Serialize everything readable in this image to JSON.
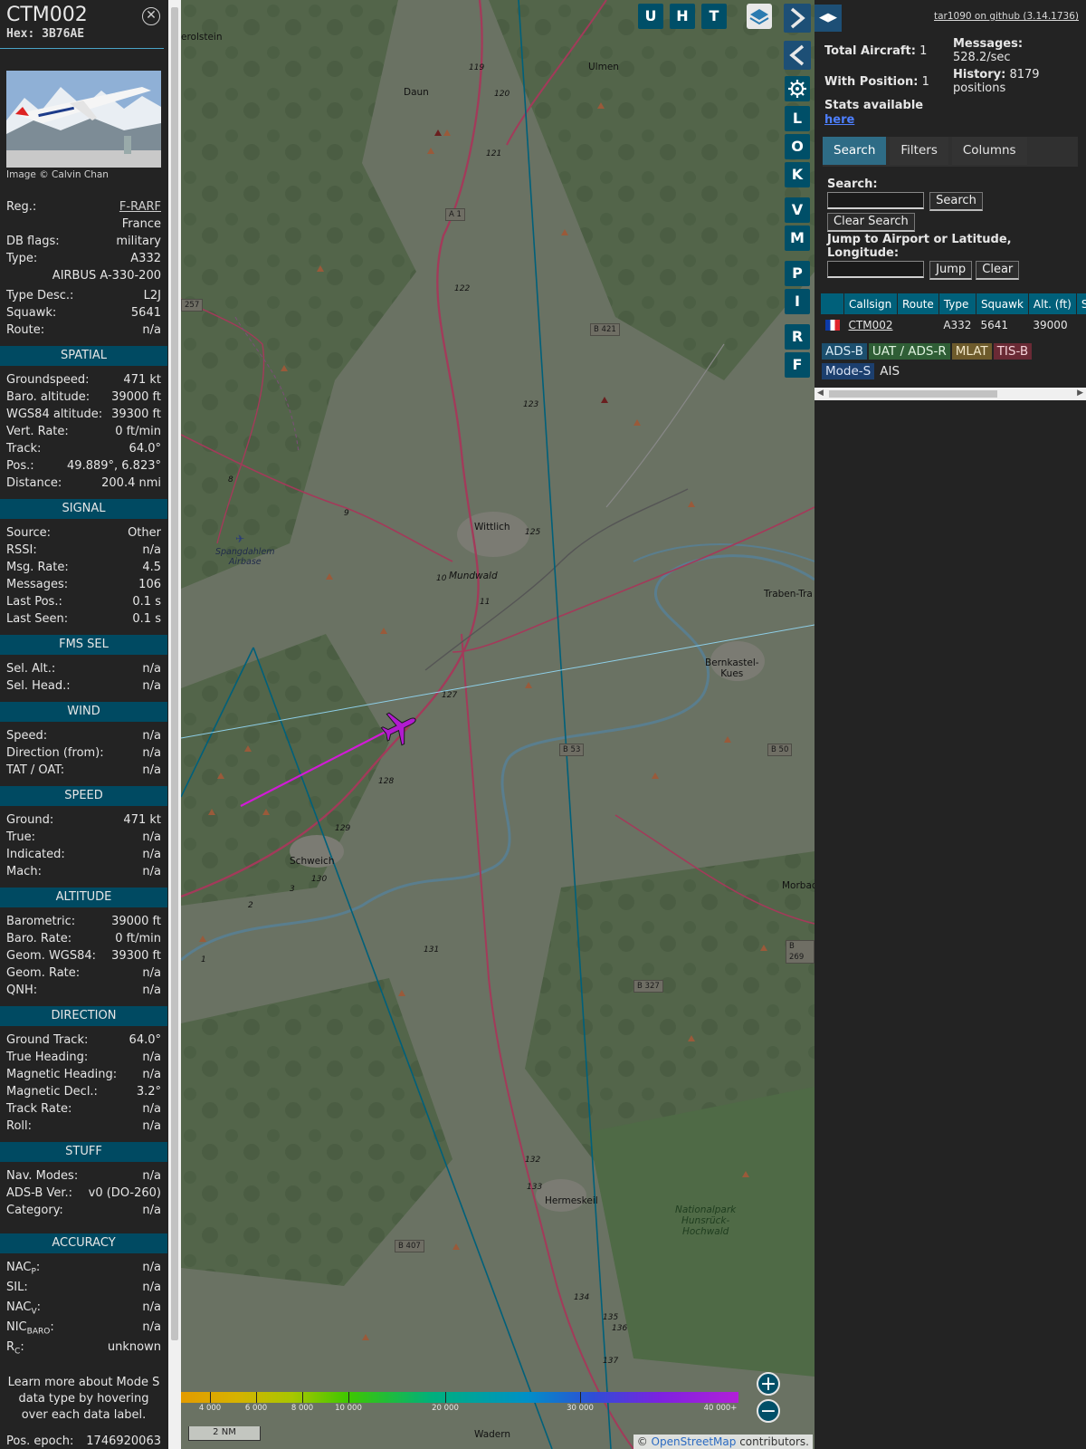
{
  "aircraft": {
    "callsign": "CTM002",
    "hex_label": "Hex:",
    "hex": "3B76AE",
    "photo_credit": "Image © Calvin Chan",
    "reg_label": "Reg.:",
    "reg": "F-RARF",
    "country": "France",
    "dbflags_label": "DB flags:",
    "dbflags": "military",
    "type_label": "Type:",
    "type": "A332",
    "type_full": "AIRBUS A-330-200",
    "typedesc_label": "Type Desc.:",
    "typedesc": "L2J",
    "squawk_label": "Squawk:",
    "squawk": "5641",
    "route_label": "Route:",
    "route": "n/a"
  },
  "sections": {
    "spatial": {
      "title": "SPATIAL",
      "rows": [
        {
          "label": "Groundspeed:",
          "value": "471 kt"
        },
        {
          "label": "Baro. altitude:",
          "value": "39000 ft"
        },
        {
          "label": "WGS84 altitude:",
          "value": "39300 ft"
        },
        {
          "label": "Vert. Rate:",
          "value": "0 ft/min"
        },
        {
          "label": "Track:",
          "value": "64.0°"
        },
        {
          "label": "Pos.:",
          "value": "49.889°, 6.823°"
        },
        {
          "label": "Distance:",
          "value": "200.4 nmi"
        }
      ]
    },
    "signal": {
      "title": "SIGNAL",
      "rows": [
        {
          "label": "Source:",
          "value": "Other"
        },
        {
          "label": "RSSI:",
          "value": "n/a"
        },
        {
          "label": "Msg. Rate:",
          "value": "4.5"
        },
        {
          "label": "Messages:",
          "value": "106"
        },
        {
          "label": "Last Pos.:",
          "value": "0.1 s"
        },
        {
          "label": "Last Seen:",
          "value": "0.1 s"
        }
      ]
    },
    "fms": {
      "title": "FMS SEL",
      "rows": [
        {
          "label": "Sel. Alt.:",
          "value": "n/a"
        },
        {
          "label": "Sel. Head.:",
          "value": "n/a"
        }
      ]
    },
    "wind": {
      "title": "WIND",
      "rows": [
        {
          "label": "Speed:",
          "value": "n/a"
        },
        {
          "label": "Direction (from):",
          "value": "n/a"
        },
        {
          "label": "TAT / OAT:",
          "value": "n/a"
        }
      ]
    },
    "speed": {
      "title": "SPEED",
      "rows": [
        {
          "label": "Ground:",
          "value": "471 kt"
        },
        {
          "label": "True:",
          "value": "n/a"
        },
        {
          "label": "Indicated:",
          "value": "n/a"
        },
        {
          "label": "Mach:",
          "value": "n/a"
        }
      ]
    },
    "altitude": {
      "title": "ALTITUDE",
      "rows": [
        {
          "label": "Barometric:",
          "value": "39000 ft"
        },
        {
          "label": "Baro. Rate:",
          "value": "0 ft/min"
        },
        {
          "label": "Geom. WGS84:",
          "value": "39300 ft"
        },
        {
          "label": "Geom. Rate:",
          "value": "n/a"
        },
        {
          "label": "QNH:",
          "value": "n/a"
        }
      ]
    },
    "direction": {
      "title": "DIRECTION",
      "rows": [
        {
          "label": "Ground Track:",
          "value": "64.0°"
        },
        {
          "label": "True Heading:",
          "value": "n/a"
        },
        {
          "label": "Magnetic Heading:",
          "value": "n/a"
        },
        {
          "label": "Magnetic Decl.:",
          "value": "3.2°"
        },
        {
          "label": "Track Rate:",
          "value": "n/a"
        },
        {
          "label": "Roll:",
          "value": "n/a"
        }
      ]
    },
    "stuff": {
      "title": "STUFF",
      "rows": [
        {
          "label": "Nav. Modes:",
          "value": "n/a"
        },
        {
          "label": "ADS-B Ver.:",
          "value": "v0 (DO-260)"
        },
        {
          "label": "Category:",
          "value": "n/a"
        }
      ]
    },
    "accuracy": {
      "title": "ACCURACY",
      "nacp_main": "NAC",
      "nacp_sub": "P",
      "nacp_value": "n/a",
      "sil_label": "SIL:",
      "sil_value": "n/a",
      "nacv_main": "NAC",
      "nacv_sub": "V",
      "nacv_value": "n/a",
      "nic_main": "NIC",
      "nic_sub": "BARO",
      "nic_value": "n/a",
      "rc_main": "R",
      "rc_sub": "C",
      "rc_value": "unknown"
    },
    "learn_more": "Learn more about Mode S data type by hovering over each data label.",
    "pos_epoch_label": "Pos. epoch:",
    "pos_epoch": "1746920063"
  },
  "map": {
    "towns": [
      "erolstein",
      "Ulmen",
      "Daun",
      "Wittlich",
      "Mundwald",
      "Traben-Tra",
      "Bernkastel-",
      "Kues",
      "Schweich",
      "Morbac",
      "Hermeskeil",
      "Nationalpark",
      "Hunsrück-",
      "Hochwald",
      "Wadern",
      "Spangdahlem",
      "Airbase"
    ],
    "roads": [
      "A 1",
      "B 421",
      "B 53",
      "B 50",
      "B 269",
      "B 327",
      "B 407",
      "257"
    ],
    "route_numbers": [
      "119",
      "120",
      "121",
      "122",
      "123",
      "125",
      "10",
      "8",
      "9",
      "127",
      "128",
      "129",
      "130",
      "131",
      "132",
      "133",
      "134",
      "135",
      "136",
      "137",
      "3",
      "2",
      "1",
      "11"
    ],
    "buttons": [
      "U",
      "H",
      "T",
      "L",
      "O",
      "K",
      "V",
      "M",
      "P",
      "I",
      "R",
      "F"
    ],
    "settings_icon": "gear-icon",
    "layers_icon": "layers-icon",
    "zoom_in": "+",
    "zoom_out": "−",
    "attribution_prefix": "© ",
    "attribution_link": "OpenStreetMap",
    "attribution_suffix": " contributors.",
    "scale": "2 NM",
    "alt_legend": [
      "4 000",
      "6 000",
      "8 000",
      "10 000",
      "20 000",
      "30 000",
      "40 000+"
    ]
  },
  "sidebar": {
    "github": "tar1090 on github (3.14.1736)",
    "total_aircraft_label": "Total Aircraft:",
    "total_aircraft": "1",
    "with_position_label": "With Position:",
    "with_position": "1",
    "stats_label": "Stats available",
    "stats_link": "here",
    "messages_label": "Messages:",
    "messages": "528.2/sec",
    "history_label": "History:",
    "history_count": "8179",
    "history_unit": "positions",
    "tabs": [
      "Search",
      "Filters",
      "Columns"
    ],
    "search_label": "Search:",
    "search_button": "Search",
    "clear_search_button": "Clear Search",
    "jump_label": "Jump to Airport or Latitude, Longitude:",
    "jump_button": "Jump",
    "clear_button": "Clear",
    "table_headers": [
      "",
      "Callsign",
      "Route",
      "Type",
      "Squawk",
      "Alt. (ft)",
      "Spd."
    ],
    "table_rows": [
      {
        "callsign": "CTM002",
        "route": "",
        "type": "A332",
        "squawk": "5641",
        "alt": "39000",
        "spd": ""
      }
    ],
    "sources": [
      {
        "label": "ADS-B",
        "bg": "#1c4f6e",
        "fg": "#d8eaf5"
      },
      {
        "label": "UAT / ADS-R",
        "bg": "#2f5e36",
        "fg": "#dff2df"
      },
      {
        "label": "MLAT",
        "bg": "#6e5b2c",
        "fg": "#f2e8c8"
      },
      {
        "label": "TIS-B",
        "bg": "#6a2a35",
        "fg": "#f5d2d8"
      },
      {
        "label": "Mode-S",
        "bg": "#1c3f6e",
        "fg": "#d8e2f5"
      },
      {
        "label": "AIS",
        "bg": "#232323",
        "fg": "#e6e6e6"
      }
    ]
  },
  "colors": {
    "section_head": "#004a62",
    "table_head": "#00607a",
    "map_button": "#004f68",
    "active_tab": "#2e6c86",
    "track": "#d11bd6"
  }
}
